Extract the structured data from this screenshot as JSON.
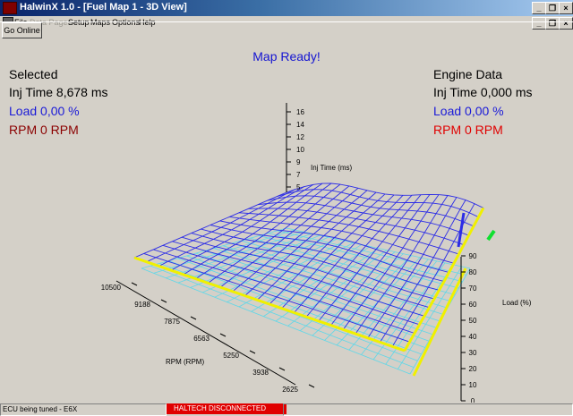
{
  "window": {
    "title": "HalwinX 1.0 - [Fuel Map 1 - 3D View]",
    "controls": [
      "_",
      "❐",
      "×"
    ],
    "mdi_controls": [
      "_",
      "❐",
      "×"
    ]
  },
  "menu": {
    "items": [
      {
        "label": "File",
        "enabled": true
      },
      {
        "label": "Data Pages",
        "enabled": false
      },
      {
        "label": "Setup",
        "enabled": true
      },
      {
        "label": "Maps",
        "enabled": true
      },
      {
        "label": "Options",
        "enabled": true
      },
      {
        "label": "Help",
        "enabled": true
      }
    ]
  },
  "toolbar": {
    "go_online_label": "Go Online"
  },
  "map_status": "Map Ready!",
  "selected_panel": {
    "heading": "Selected",
    "inj_time": "Inj Time 8,678 ms",
    "load": "Load 0,00 %",
    "rpm": "RPM 0 RPM"
  },
  "engine_panel": {
    "heading": "Engine Data",
    "inj_time": "Inj Time 0,000 ms",
    "load": "Load 0,00 %",
    "rpm": "RPM 0 RPM"
  },
  "chart_data": {
    "type": "surface3d",
    "z_axis": {
      "label": "Inj Time (ms)",
      "ticks": [
        "16",
        "14",
        "12",
        "10",
        "9",
        "7",
        "5"
      ]
    },
    "x_axis": {
      "label": "RPM (RPM)",
      "ticks": [
        "10500",
        "9188",
        "7875",
        "6563",
        "5250",
        "3938",
        "2625"
      ]
    },
    "y_axis": {
      "label": "Load (%)",
      "ticks": [
        "0",
        "10",
        "20",
        "30",
        "40",
        "50",
        "60",
        "70",
        "80",
        "90"
      ]
    },
    "colors": {
      "top_mesh": "#2c2ce6",
      "side_mesh": "#5fd7e8",
      "highlight": "#f0f000",
      "marker": "#10e030"
    }
  },
  "status_bar": {
    "left": "ECU being tuned - E6X",
    "connection": "HALTECH DISCONNECTED",
    "connection_color": "#e00000"
  }
}
